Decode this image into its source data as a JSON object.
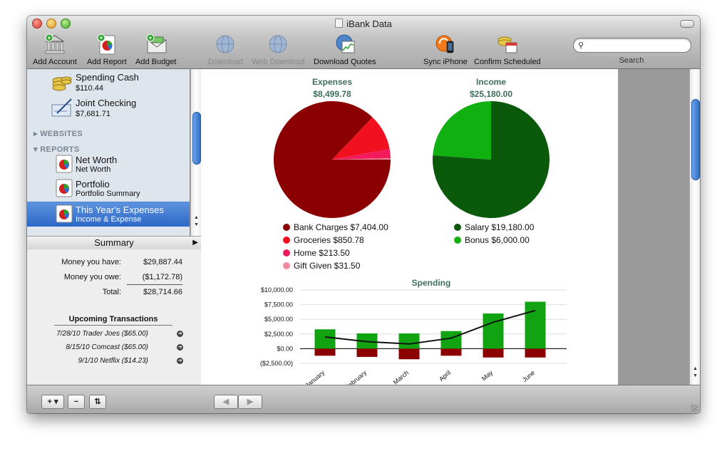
{
  "window": {
    "title": "iBank Data"
  },
  "toolbar": {
    "add_account": "Add Account",
    "add_report": "Add Report",
    "add_budget": "Add Budget",
    "download": "Download",
    "web_download": "Web Download",
    "download_quotes": "Download Quotes",
    "sync_iphone": "Sync iPhone",
    "confirm_scheduled": "Confirm Scheduled",
    "search_label": "Search"
  },
  "sidebar": {
    "accounts": [
      {
        "name": "Spending Cash",
        "balance": "$110.44",
        "icon": "coins-icon"
      },
      {
        "name": "Joint Checking",
        "balance": "$7,681.71",
        "icon": "checkbook-icon"
      }
    ],
    "websites_header": "WEBSITES",
    "reports_header": "REPORTS",
    "reports": [
      {
        "name": "Net Worth",
        "subtitle": "Net Worth"
      },
      {
        "name": "Portfolio",
        "subtitle": "Portfolio Summary"
      },
      {
        "name": "This Year's Expenses",
        "subtitle": "Income & Expense",
        "selected": true
      }
    ]
  },
  "summary": {
    "title": "Summary",
    "have_label": "Money you have:",
    "have_value": "$29,887.44",
    "owe_label": "Money you owe:",
    "owe_value": "($1,172.78)",
    "total_label": "Total:",
    "total_value": "$28,714.66",
    "upcoming_title": "Upcoming Transactions",
    "upcoming": [
      "7/28/10 Trader Joes ($65.00)",
      "8/15/10 Comcast ($65.00)",
      "9/1/10 Netflix ($14.23)"
    ]
  },
  "report": {
    "expenses_title": "Expenses",
    "expenses_total": "$8,499.78",
    "income_title": "Income",
    "income_total": "$25,180.00",
    "spending_title": "Spending",
    "expense_legend": [
      {
        "label": "Bank Charges $7,404.00",
        "color": "#8b0000"
      },
      {
        "label": "Groceries $850.78",
        "color": "#f0101f"
      },
      {
        "label": "Home $213.50",
        "color": "#f21b5b"
      },
      {
        "label": "Gift Given $31.50",
        "color": "#f08aa0"
      }
    ],
    "income_legend": [
      {
        "label": "Salary $19,180.00",
        "color": "#0b5a0b"
      },
      {
        "label": "Bonus $6,000.00",
        "color": "#0fb00f"
      }
    ]
  },
  "chart_data": [
    {
      "type": "pie",
      "title": "Expenses",
      "subtitle": "$8,499.78",
      "categories": [
        "Bank Charges",
        "Groceries",
        "Home",
        "Gift Given"
      ],
      "values": [
        7404.0,
        850.78,
        213.5,
        31.5
      ],
      "colors": [
        "#8b0000",
        "#f0101f",
        "#f21b5b",
        "#f08aa0"
      ],
      "legend": "bottom"
    },
    {
      "type": "pie",
      "title": "Income",
      "subtitle": "$25,180.00",
      "categories": [
        "Salary",
        "Bonus"
      ],
      "values": [
        19180.0,
        6000.0
      ],
      "colors": [
        "#0b5a0b",
        "#0fb00f"
      ],
      "legend": "bottom"
    },
    {
      "type": "bar",
      "title": "Spending",
      "categories": [
        "January",
        "February",
        "March",
        "April",
        "May",
        "June"
      ],
      "series": [
        {
          "values": [
            3300,
            2600,
            2600,
            3000,
            6000,
            8000
          ],
          "color": "#12a312"
        },
        {
          "values": [
            -1200,
            -1400,
            -1800,
            -1200,
            -1500,
            -1500
          ],
          "color": "#8b0000"
        }
      ],
      "line": [
        2000,
        1200,
        800,
        1800,
        4500,
        6500
      ],
      "yticks": [
        "$10,000.00",
        "$7,500.00",
        "$5,000.00",
        "$2,500.00",
        "$0.00",
        "($2,500.00)"
      ],
      "ylim": [
        -2500,
        10000
      ],
      "grid": true
    }
  ]
}
